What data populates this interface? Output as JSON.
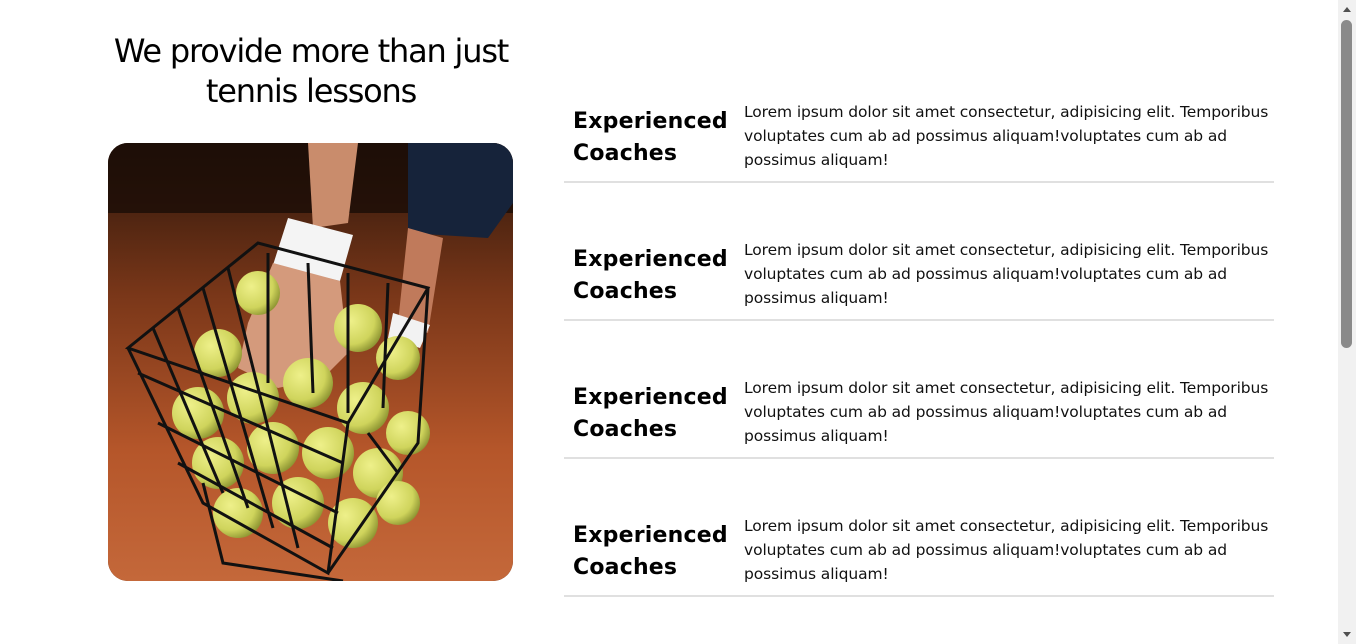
{
  "headline": "We provide more than just tennis lessons",
  "features": [
    {
      "title": "Experienced Coaches",
      "text": "Lorem ipsum dolor sit amet consectetur, adipisicing elit. Temporibus voluptates cum ab ad possimus aliquam!voluptates cum ab ad possimus aliquam!"
    },
    {
      "title": "Experienced Coaches",
      "text": "Lorem ipsum dolor sit amet consectetur, adipisicing elit. Temporibus voluptates cum ab ad possimus aliquam!voluptates cum ab ad possimus aliquam!"
    },
    {
      "title": "Experienced Coaches",
      "text": "Lorem ipsum dolor sit amet consectetur, adipisicing elit. Temporibus voluptates cum ab ad possimus aliquam!voluptates cum ab ad possimus aliquam!"
    },
    {
      "title": "Experienced Coaches",
      "text": "Lorem ipsum dolor sit amet consectetur, adipisicing elit. Temporibus voluptates cum ab ad possimus aliquam!voluptates cum ab ad possimus aliquam!"
    }
  ],
  "image": {
    "icon": "tennis-ball-basket-photo"
  },
  "colors": {
    "background": "#ffffff",
    "text": "#000000",
    "divider": "#e0e0e0",
    "clay": "#b5562a",
    "ball": "#d6dc6a"
  }
}
